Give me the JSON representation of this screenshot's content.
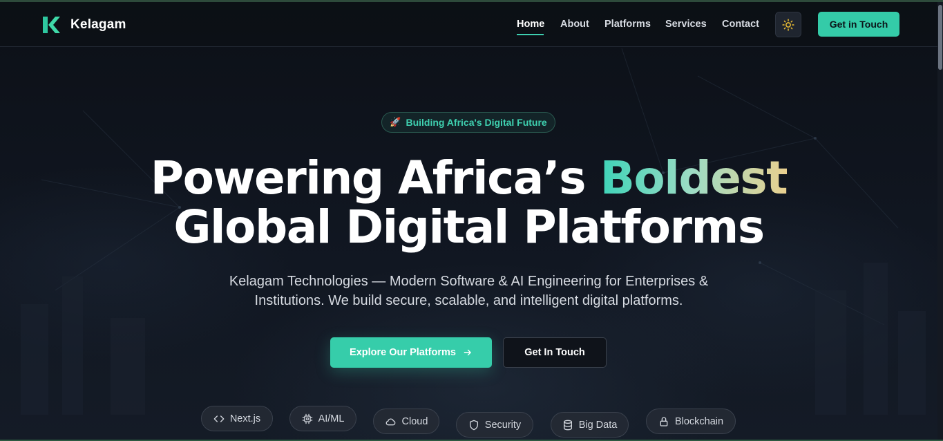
{
  "brand": {
    "name": "Kelagam",
    "accent": "#34cba8"
  },
  "nav": {
    "items": [
      {
        "label": "Home",
        "active": true
      },
      {
        "label": "About"
      },
      {
        "label": "Platforms"
      },
      {
        "label": "Services"
      },
      {
        "label": "Contact"
      }
    ],
    "theme_toggle_icon": "sun-icon",
    "cta_label": "Get in Touch"
  },
  "hero": {
    "badge": {
      "icon": "rocket-icon",
      "text": "Building Africa's Digital Future"
    },
    "headline": {
      "line1_prefix": "Powering Africa’s ",
      "line1_highlight": "Boldest",
      "line2": "Global Digital Platforms"
    },
    "subtitle": "Kelagam Technologies — Modern Software & AI Engineering for Enterprises & Institutions. We build secure, scalable, and intelligent digital platforms.",
    "primary_cta": {
      "label": "Explore Our Platforms",
      "icon": "arrow-right-icon"
    },
    "secondary_cta": {
      "label": "Get In Touch"
    }
  },
  "tech_chips": [
    {
      "label": "Next.js",
      "icon": "code-icon"
    },
    {
      "label": "AI/ML",
      "icon": "cpu-icon"
    },
    {
      "label": "Cloud",
      "icon": "cloud-icon"
    },
    {
      "label": "Security",
      "icon": "shield-icon"
    },
    {
      "label": "Big Data",
      "icon": "database-icon"
    },
    {
      "label": "Blockchain",
      "icon": "lock-icon"
    }
  ]
}
